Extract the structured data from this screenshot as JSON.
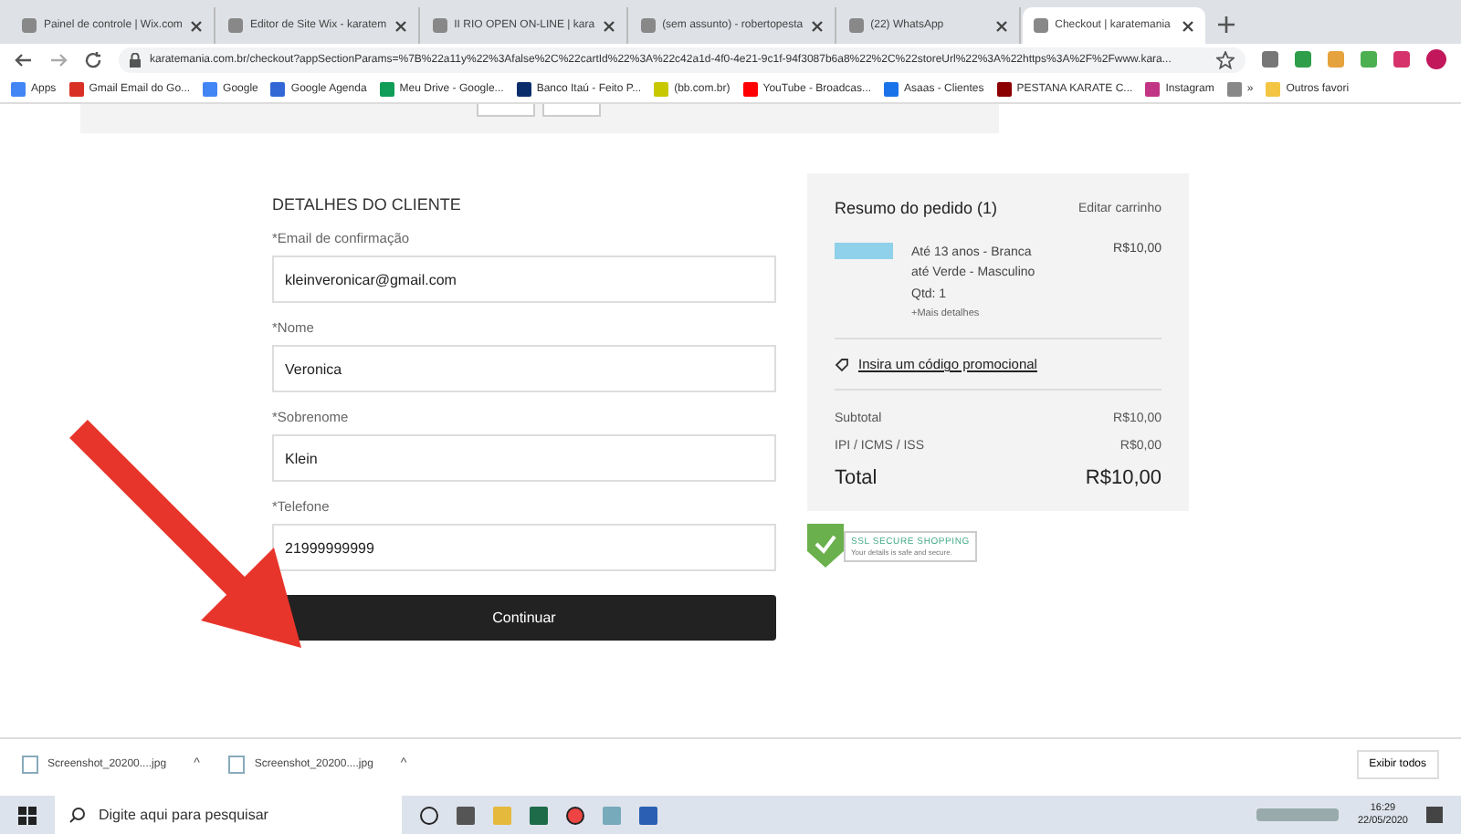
{
  "browser": {
    "tabs": [
      {
        "title": "Painel de controle | Wix.com",
        "selected": false
      },
      {
        "title": "Editor de Site Wix - karatem",
        "selected": false
      },
      {
        "title": "II RIO OPEN ON-LINE | kara",
        "selected": false
      },
      {
        "title": "(sem assunto) - robertopesta",
        "selected": false
      },
      {
        "title": "(22) WhatsApp",
        "selected": false
      },
      {
        "title": "Checkout | karatemania",
        "selected": true
      }
    ],
    "address": "karatemania.com.br/checkout?appSectionParams=%7B%22a11y%22%3Afalse%2C%22cartId%22%3A%22c42a1d-4f0-4e21-9c1f-94f3087b6a8%22%2C%22storeUrl%22%3A%22https%3A%2F%2Fwww.kara...",
    "bookmarks": [
      "Apps",
      "Gmail Email do Go...",
      "Google",
      "Google Agenda",
      "Meu Drive - Google...",
      "Banco Itaú - Feito P...",
      "(bb.com.br)",
      "YouTube - Broadcas...",
      "Asaas - Clientes",
      "PESTANA KARATE C...",
      "Instagram",
      "»",
      "Outros favori"
    ]
  },
  "customer": {
    "heading": "DETALHES DO CLIENTE",
    "fields": [
      {
        "label": "*Email de confirmação",
        "value": "kleinveronicar@gmail.com"
      },
      {
        "label": "*Nome",
        "value": "Veronica"
      },
      {
        "label": "*Sobrenome",
        "value": "Klein"
      },
      {
        "label": "*Telefone",
        "value": "21999999999"
      }
    ],
    "button": "Continuar"
  },
  "summary": {
    "title": "Resumo do pedido (1)",
    "edit": "Editar carrinho",
    "item": {
      "name": "Até 13 anos - Branca até Verde - Masculino",
      "price": "R$10,00",
      "qty": "Qtd: 1",
      "details": "+Mais detalhes"
    },
    "promo": "Insira um código promocional",
    "lines": [
      {
        "label": "Subtotal",
        "value": "R$10,00"
      },
      {
        "label": "IPI / ICMS / ISS",
        "value": "R$0,00"
      }
    ],
    "total_label": "Total",
    "total": "R$10,00"
  },
  "ssl": {
    "title": "SSL SECURE SHOPPING",
    "subtitle": "Your details is safe and secure."
  },
  "downloads": [
    {
      "name": "Screenshot_20200....jpg",
      "caret": "^"
    },
    {
      "name": "Screenshot_20200....jpg",
      "caret": "^"
    }
  ],
  "show_all": "Exibir todos",
  "taskbar": {
    "search_placeholder": "Digite aqui para pesquisar",
    "time": "16:29",
    "date": "22/05/2020"
  }
}
